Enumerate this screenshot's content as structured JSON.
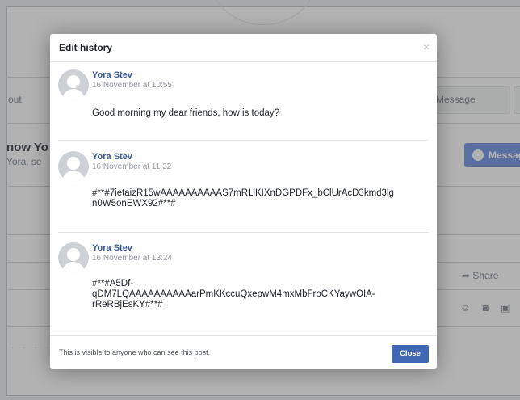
{
  "background": {
    "nav_about": "out",
    "nav_message_placeholder": "Message",
    "people_you_may_know": "now Yo",
    "people_sub": "Yora, se",
    "message_button": "Messag",
    "share_label": "Share"
  },
  "dialog": {
    "title": "Edit history",
    "close_glyph": "×",
    "entries": [
      {
        "author": "Yora Stev",
        "date": "16 November at 10:55",
        "text": "Good morning my dear friends, how is today?"
      },
      {
        "author": "Yora Stev",
        "date": "16 November at 11:32",
        "text": "#**#7ietaizR15wAAAAAAAAAAS7mRLlKIXnDGPDFx_bClUrAcD3kmd3lgn0W5onEWX92#**#"
      },
      {
        "author": "Yora Stev",
        "date": "16 November at 13:24",
        "text": "#**#A5Df-qDM7LQAAAAAAAAAAarPmKKccuQxepwM4mxMbFroCKYaywOIA-rReRBjEsKY#**#"
      }
    ],
    "footer_note": "This is visible to anyone who can see this post.",
    "close_button": "Close"
  },
  "colors": {
    "accent": "#4267b2",
    "link": "#385898",
    "overlay": "rgba(0,0,0,0.30)"
  }
}
